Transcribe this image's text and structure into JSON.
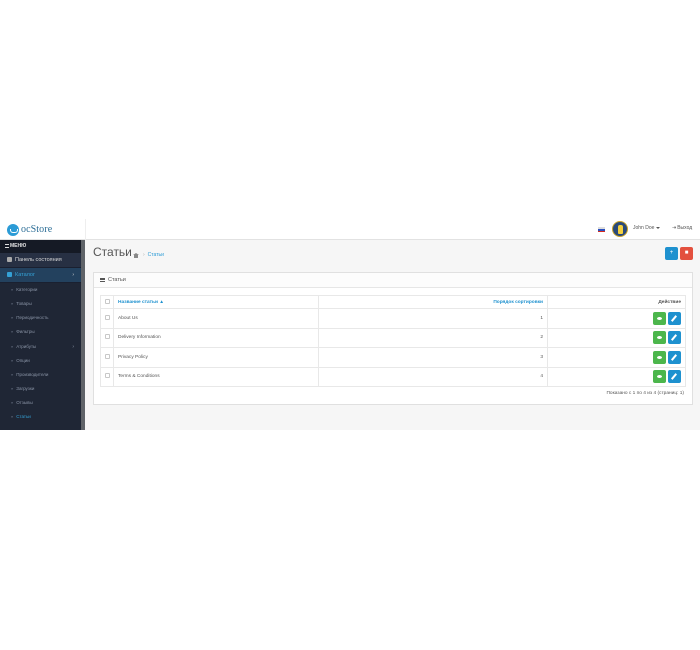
{
  "header": {
    "brand": "ocStore",
    "user_name": "John Doe",
    "logout_label": "Выход"
  },
  "sidebar": {
    "menu_label": "МЕНЮ",
    "dashboard_label": "Панель состояния",
    "catalog_label": "Каталог",
    "items": [
      {
        "label": "Категории"
      },
      {
        "label": "Товары"
      },
      {
        "label": "Периодичность"
      },
      {
        "label": "Фильтры"
      },
      {
        "label": "Атрибуты"
      },
      {
        "label": "Опции"
      },
      {
        "label": "Производители"
      },
      {
        "label": "Загрузки"
      },
      {
        "label": "Отзывы"
      },
      {
        "label": "Статьи"
      }
    ]
  },
  "page": {
    "title": "Статьи",
    "breadcrumb": "Статьи",
    "panel_title": "Статьи"
  },
  "table": {
    "headers": {
      "name": "Название статьи ▲",
      "sort": "Порядок сортировки",
      "action": "Действие"
    },
    "rows": [
      {
        "name": "About Us",
        "sort": "1"
      },
      {
        "name": "Delivery Information",
        "sort": "2"
      },
      {
        "name": "Privacy Policy",
        "sort": "3"
      },
      {
        "name": "Terms & Conditions",
        "sort": "4"
      }
    ],
    "footer": "Показано с 1 по 4 из 4 (страниц: 1)"
  },
  "colors": {
    "primary": "#1e91cf",
    "danger": "#e3503e",
    "success": "#4cb64c",
    "sidebar_bg": "#1f2635"
  }
}
